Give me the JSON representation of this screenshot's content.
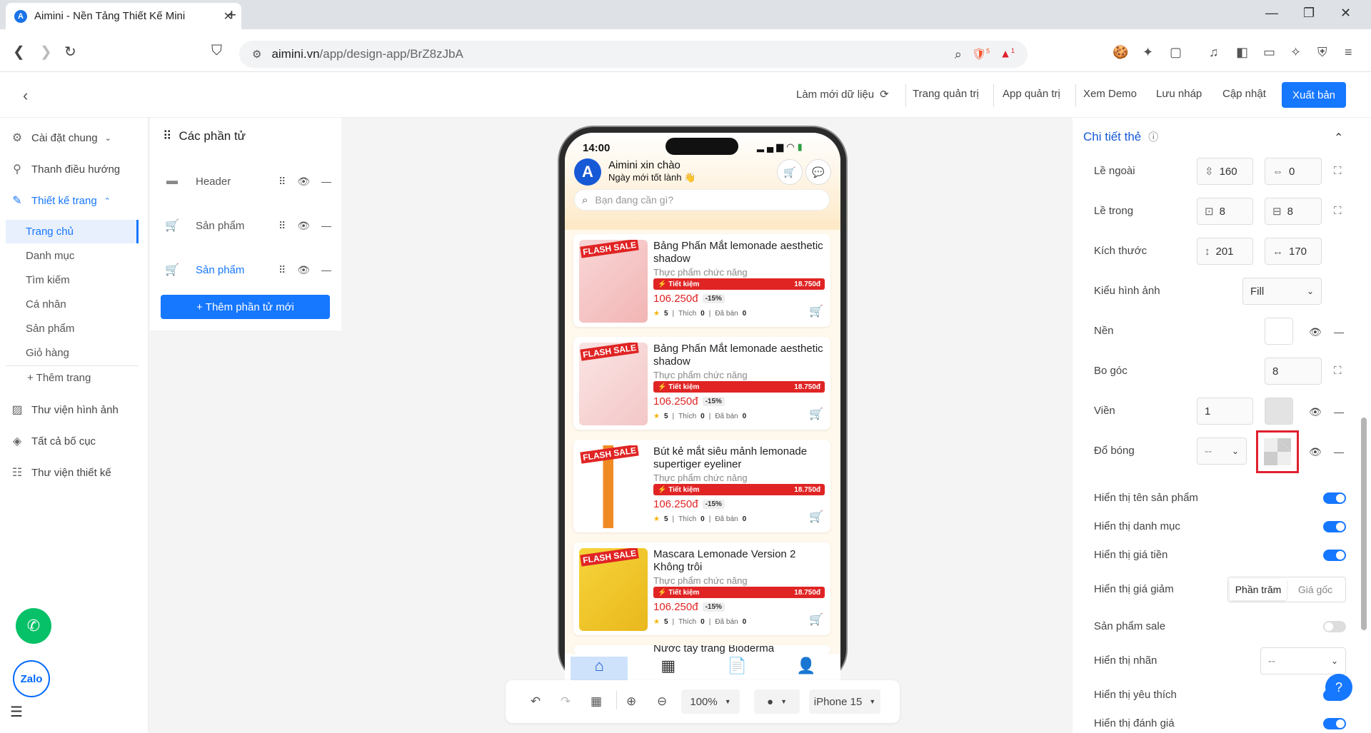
{
  "browser": {
    "tab_title": "Aimini - Nền Tảng Thiết Kế Mini",
    "tab_favicon": "A",
    "new_tab": "+",
    "url_host": "aimini.vn",
    "url_path": "/app/design-app/BrZ8zJbA",
    "brave_badge": "5",
    "alert_badge": "1"
  },
  "header": {
    "actions": [
      "Làm mới dữ liệu",
      "Trang quản trị",
      "App quản trị",
      "Xem Demo",
      "Lưu nháp",
      "Cập nhật"
    ],
    "publish": "Xuất bản"
  },
  "sidebar": {
    "items": [
      {
        "label": "Cài đặt chung",
        "icon": "settings-icon"
      },
      {
        "label": "Thanh điều hướng",
        "icon": "navigation-icon"
      },
      {
        "label": "Thiết kế trang",
        "icon": "design-icon"
      }
    ],
    "pages": [
      "Trang chủ",
      "Danh mục",
      "Tìm kiếm",
      "Cá nhân",
      "Sản phẩm",
      "Giỏ hàng"
    ],
    "add_page": "+ Thêm trang",
    "bottom_items": [
      {
        "label": "Thư viện hình ảnh",
        "icon": "image-library-icon"
      },
      {
        "label": "Tất cả bố cục",
        "icon": "layers-icon"
      },
      {
        "label": "Thư viện thiết kế",
        "icon": "grid-library-icon"
      }
    ],
    "zalo": "Zalo"
  },
  "elements_panel": {
    "title": "Các phần tử",
    "rows": [
      {
        "label": "Header"
      },
      {
        "label": "Sản phẩm"
      },
      {
        "label": "Sản phẩm"
      }
    ],
    "add_button": "+ Thêm phần tử mới"
  },
  "phone": {
    "time": "14:00",
    "avatar_letter": "A",
    "greeting": "Aimini xin chào",
    "subgreeting": "Ngày mới tốt lành 👋",
    "search_placeholder": "Bạn đang cần gì?",
    "flash": "FLASH SALE",
    "products": [
      {
        "name": "Bảng Phấn Mắt lemonade aesthetic shadow",
        "category": "Thực phẩm chức năng",
        "save_label": "⚡ Tiết kiệm",
        "save_amount": "18.750đ",
        "price": "106.250đ",
        "discount": "-15%",
        "rating": "5",
        "likes_label": "Thích",
        "likes": "0",
        "sold_label": "Đã bán",
        "sold": "0"
      },
      {
        "name": "Bảng Phấn Mắt lemonade aesthetic shadow",
        "category": "Thực phẩm chức năng",
        "save_label": "⚡ Tiết kiệm",
        "save_amount": "18.750đ",
        "price": "106.250đ",
        "discount": "-15%",
        "rating": "5",
        "likes_label": "Thích",
        "likes": "0",
        "sold_label": "Đã bán",
        "sold": "0"
      },
      {
        "name": "Bút kẻ mắt siêu mảnh lemonade supertiger eyeliner",
        "category": "Thực phẩm chức năng",
        "save_label": "⚡ Tiết kiệm",
        "save_amount": "18.750đ",
        "price": "106.250đ",
        "discount": "-15%",
        "rating": "5",
        "likes_label": "Thích",
        "likes": "0",
        "sold_label": "Đã bán",
        "sold": "0"
      },
      {
        "name": "Mascara Lemonade Version 2 Không trôi",
        "category": "Thực phẩm chức năng",
        "save_label": "⚡ Tiết kiệm",
        "save_amount": "18.750đ",
        "price": "106.250đ",
        "discount": "-15%",
        "rating": "5",
        "likes_label": "Thích",
        "likes": "0",
        "sold_label": "Đã bán",
        "sold": "0"
      }
    ],
    "partial_product": "Nước tẩy trang Bioderma"
  },
  "toolbar": {
    "zoom": "100%",
    "device": "iPhone 15"
  },
  "details": {
    "title": "Chi tiết thẻ",
    "margin_label": "Lề ngoài",
    "margin_v": "160",
    "margin_h": "0",
    "padding_label": "Lề trong",
    "padding_v": "8",
    "padding_h": "8",
    "size_label": "Kích thước",
    "height": "201",
    "width": "170",
    "image_style_label": "Kiểu hình ảnh",
    "image_style": "Fill",
    "bg_label": "Nền",
    "radius_label": "Bo góc",
    "radius": "8",
    "border_label": "Viền",
    "border": "1",
    "shadow_label": "Đổ bóng",
    "shadow": "--",
    "toggles": [
      {
        "label": "Hiển thị tên sản phẩm",
        "on": true
      },
      {
        "label": "Hiển thị danh mục",
        "on": true
      },
      {
        "label": "Hiển thị giá tiền",
        "on": true
      }
    ],
    "discount_label": "Hiển thị giá giảm",
    "discount_options": [
      "Phần trăm",
      "Giá gốc"
    ],
    "sale_label": "Sản phẩm sale",
    "tag_label": "Hiển thị nhãn",
    "tag_value": "--",
    "fav_label": "Hiển thị yêu thích",
    "review_label": "Hiển thị đánh giá"
  },
  "colors": {
    "accent": "#1677ff",
    "danger": "#e02424",
    "highlight": "#e0202e"
  }
}
